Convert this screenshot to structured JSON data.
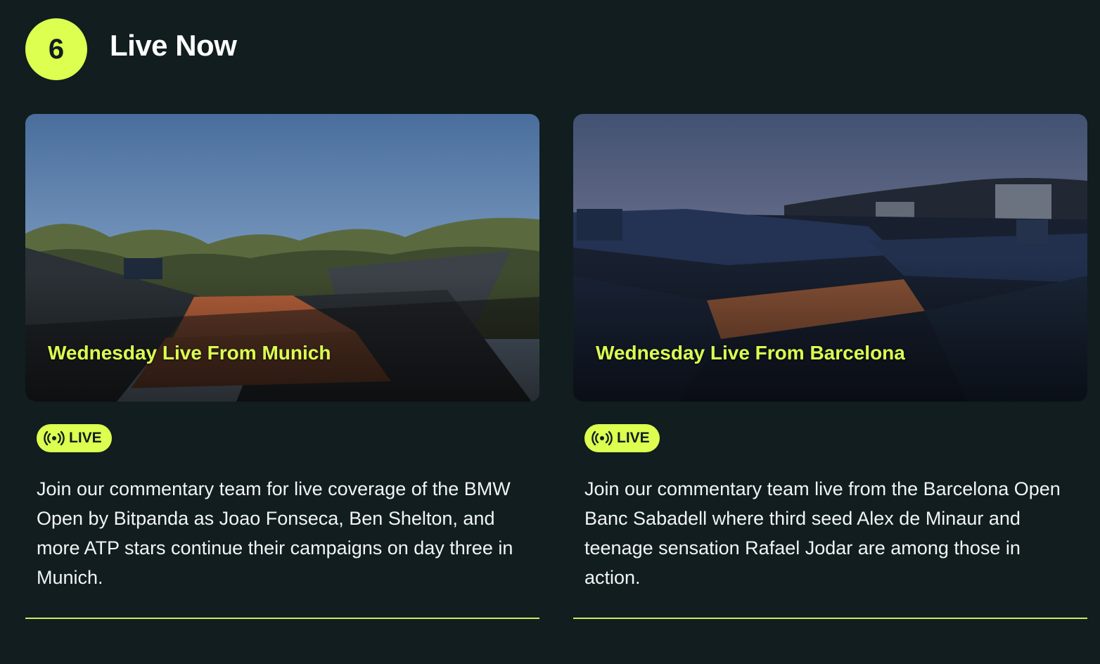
{
  "header": {
    "count": "6",
    "title": "Live Now"
  },
  "cards": [
    {
      "title": "Wednesday Live From Munich",
      "badge": "LIVE",
      "description": "Join our commentary team for live coverage of the BMW Open by Bitpanda as Joao Fonseca, Ben Shelton, and more ATP stars continue their campaigns on day three in Munich.",
      "image": "tennis-stadium-munich-photo"
    },
    {
      "title": "Wednesday Live From Barcelona",
      "badge": "LIVE",
      "description": "Join our commentary team live from the Barcelona Open Banc Sabadell where third seed Alex de Minaur and teenage sensation Rafael Jodar are among those in action.",
      "image": "tennis-stadium-barcelona-photo"
    }
  ],
  "colors": {
    "background": "#111d1f",
    "accent": "#dcff50",
    "text": "#ffffff"
  }
}
